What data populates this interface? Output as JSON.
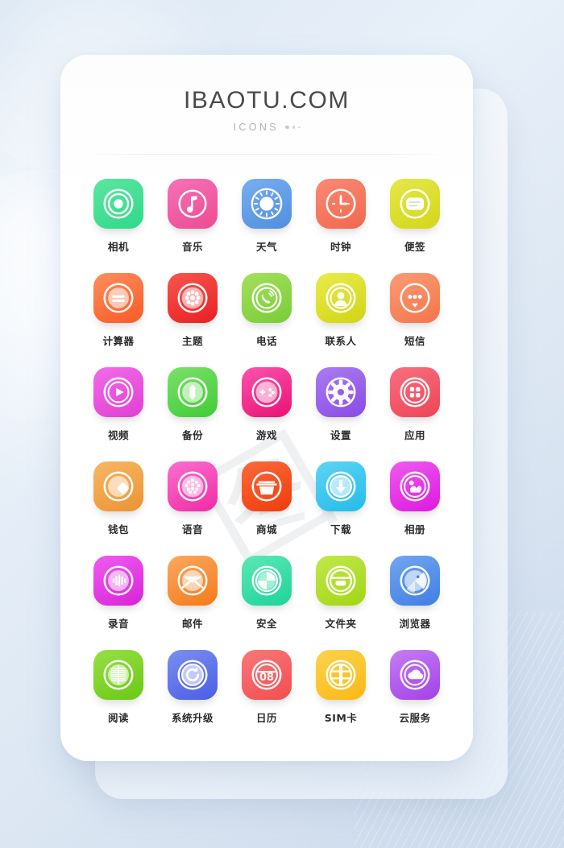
{
  "header": {
    "title": "IBAOTU.COM",
    "subtitle": "ICONS"
  },
  "watermark": "图",
  "colors": {
    "page_background_top": "#dbe7f4",
    "page_background_bottom": "#ccd9ea",
    "card_background": "#ffffff",
    "title_color": "#4a4a4a",
    "subtitle_color": "#b2b2b2",
    "label_color": "#2b2b2b"
  },
  "apps": [
    {
      "label": "相机",
      "icon": "camera-icon",
      "color_from": "#5ce6a0",
      "color_to": "#2fd98a"
    },
    {
      "label": "音乐",
      "icon": "music-note-icon",
      "color_from": "#f munged",
      "color_to": "#ef4a92"
    },
    {
      "label": "天气",
      "icon": "sun-weather-icon",
      "color_from": "#79aef0",
      "color_to": "#4f8fe0"
    },
    {
      "label": "时钟",
      "icon": "clock-icon",
      "color_from": "#fa8a74",
      "color_to": "#f2674d"
    },
    {
      "label": "便签",
      "icon": "notes-icon",
      "color_from": "#e3e84a",
      "color_to": "#d4d617"
    },
    {
      "label": "计算器",
      "icon": "calculator-icon",
      "color_from": "#fd8e5e",
      "color_to": "#fa5a26"
    },
    {
      "label": "主题",
      "icon": "theme-flower-icon",
      "color_from": "#f8564f",
      "color_to": "#e81f22"
    },
    {
      "label": "电话",
      "icon": "phone-icon",
      "color_from": "#a4e05c",
      "color_to": "#79cc38"
    },
    {
      "label": "联系人",
      "icon": "contacts-icon",
      "color_from": "#e9ec4d",
      "color_to": "#d2d413"
    },
    {
      "label": "短信",
      "icon": "message-icon",
      "color_from": "#fb9b73",
      "color_to": "#f4754c"
    },
    {
      "label": "视频",
      "icon": "play-video-icon",
      "color_from": "#f06ce8",
      "color_to": "#e33ed2"
    },
    {
      "label": "备份",
      "icon": "backup-sync-icon",
      "color_from": "#7ce06a",
      "color_to": "#3fcc36"
    },
    {
      "label": "游戏",
      "icon": "gamepad-icon",
      "color_from": "#fb54ae",
      "color_to": "#ea1072"
    },
    {
      "label": "设置",
      "icon": "gear-settings-icon",
      "color_from": "#a97df0",
      "color_to": "#8a4ae6"
    },
    {
      "label": "应用",
      "icon": "apps-grid-icon",
      "color_from": "#f8707f",
      "color_to": "#ef4457"
    },
    {
      "label": "钱包",
      "icon": "wallet-coin-icon",
      "color_from": "#f7b765",
      "color_to": "#ec9332"
    },
    {
      "label": "语音",
      "icon": "voice-dots-icon",
      "color_from": "#fb6fd0",
      "color_to": "#f02ba4"
    },
    {
      "label": "商城",
      "icon": "shop-basket-icon",
      "color_from": "#fb6a39",
      "color_to": "#ef3c0c"
    },
    {
      "label": "下载",
      "icon": "download-arrow-icon",
      "color_from": "#5ed4f5",
      "color_to": "#22bce9"
    },
    {
      "label": "相册",
      "icon": "photo-album-icon",
      "color_from": "#ef5bf0",
      "color_to": "#dd18dd"
    },
    {
      "label": "录音",
      "icon": "recorder-wave-icon",
      "color_from": "#ee5cf2",
      "color_to": "#d923d6"
    },
    {
      "label": "邮件",
      "icon": "mail-envelope-icon",
      "color_from": "#fba85f",
      "color_to": "#f57a18"
    },
    {
      "label": "安全",
      "icon": "security-shield-icon",
      "color_from": "#5ce8b6",
      "color_to": "#1ed39a"
    },
    {
      "label": "文件夹",
      "icon": "folder-icon",
      "color_from": "#c0e84c",
      "color_to": "#a2d613"
    },
    {
      "label": "浏览器",
      "icon": "browser-compass-icon",
      "color_from": "#72a6ef",
      "color_to": "#3f7ee4"
    },
    {
      "label": "阅读",
      "icon": "reading-book-icon",
      "color_from": "#96e044",
      "color_to": "#6ac914"
    },
    {
      "label": "系统升级",
      "icon": "system-update-icon",
      "color_from": "#7b8ff0",
      "color_to": "#4b5de6"
    },
    {
      "label": "日历",
      "icon": "calendar-icon",
      "color_from": "#fa7878",
      "color_to": "#f24d50",
      "badge": "08"
    },
    {
      "label": "SIM卡",
      "icon": "sim-card-icon",
      "color_from": "#fdd34c",
      "color_to": "#fbb814"
    },
    {
      "label": "云服务",
      "icon": "cloud-service-icon",
      "color_from": "#c47ef2",
      "color_to": "#a440e8"
    }
  ]
}
